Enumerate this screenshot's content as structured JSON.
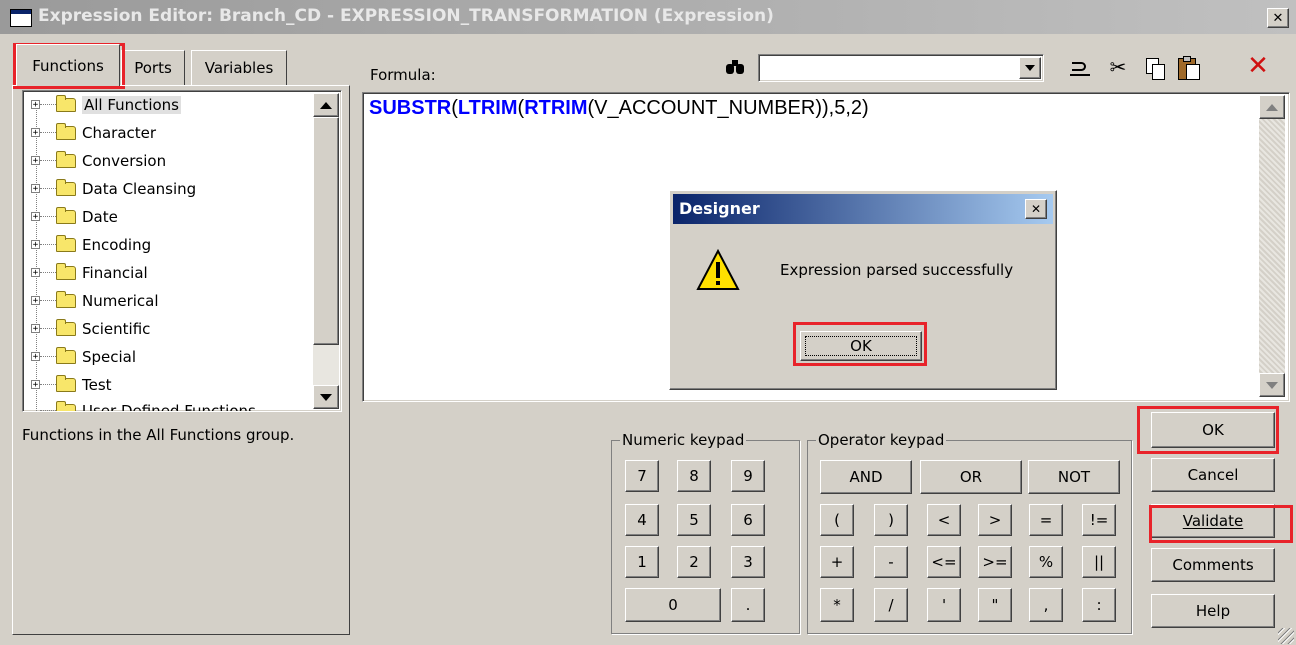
{
  "window": {
    "title": "Expression Editor: Branch_CD - EXPRESSION_TRANSFORMATION (Expression)",
    "close_glyph": "✕"
  },
  "tabs": [
    {
      "label": "Functions"
    },
    {
      "label": "Ports"
    },
    {
      "label": "Variables"
    }
  ],
  "tree": {
    "items": [
      {
        "label": "All Functions"
      },
      {
        "label": "Character"
      },
      {
        "label": "Conversion"
      },
      {
        "label": "Data Cleansing"
      },
      {
        "label": "Date"
      },
      {
        "label": "Encoding"
      },
      {
        "label": "Financial"
      },
      {
        "label": "Numerical"
      },
      {
        "label": "Scientific"
      },
      {
        "label": "Special"
      },
      {
        "label": "Test"
      },
      {
        "label": "User Defined Functions"
      }
    ],
    "description": "Functions in the All Functions group."
  },
  "formula": {
    "label": "Formula:",
    "parts": {
      "f1": "SUBSTR",
      "p1": "(",
      "f2": "LTRIM",
      "p2": "(",
      "f3": "RTRIM",
      "rest": "(V_ACCOUNT_NUMBER)),5,2)"
    },
    "function_color": "#0000ff"
  },
  "toolbar": {
    "find_icon": "binoculars-icon",
    "search_value": "",
    "icons": [
      "undo-icon",
      "cut-icon",
      "copy-icon",
      "paste-icon",
      "delete-icon"
    ]
  },
  "dialog": {
    "title": "Designer",
    "message": "Expression parsed successfully",
    "ok_label": "OK",
    "icon": "warning-icon"
  },
  "numeric_keypad": {
    "label": "Numeric keypad",
    "keys": [
      "7",
      "8",
      "9",
      "4",
      "5",
      "6",
      "1",
      "2",
      "3"
    ],
    "zero": "0",
    "dot": "."
  },
  "operator_keypad": {
    "label": "Operator keypad",
    "row1": [
      "AND",
      "OR",
      "NOT"
    ],
    "row2": [
      "(",
      ")",
      "<",
      ">",
      "=",
      "!="
    ],
    "row3": [
      "+",
      "-",
      "<=",
      ">=",
      "%",
      "||"
    ],
    "row4": [
      "*",
      "/",
      "'",
      "\"",
      ",",
      ":"
    ]
  },
  "buttons": {
    "ok": "OK",
    "cancel": "Cancel",
    "validate": "Validate",
    "comments": "Comments",
    "help": "Help"
  },
  "colors": {
    "title_bar_start": "#0a246a",
    "title_bar_end": "#a6caf0",
    "highlight": "#e8232a"
  }
}
